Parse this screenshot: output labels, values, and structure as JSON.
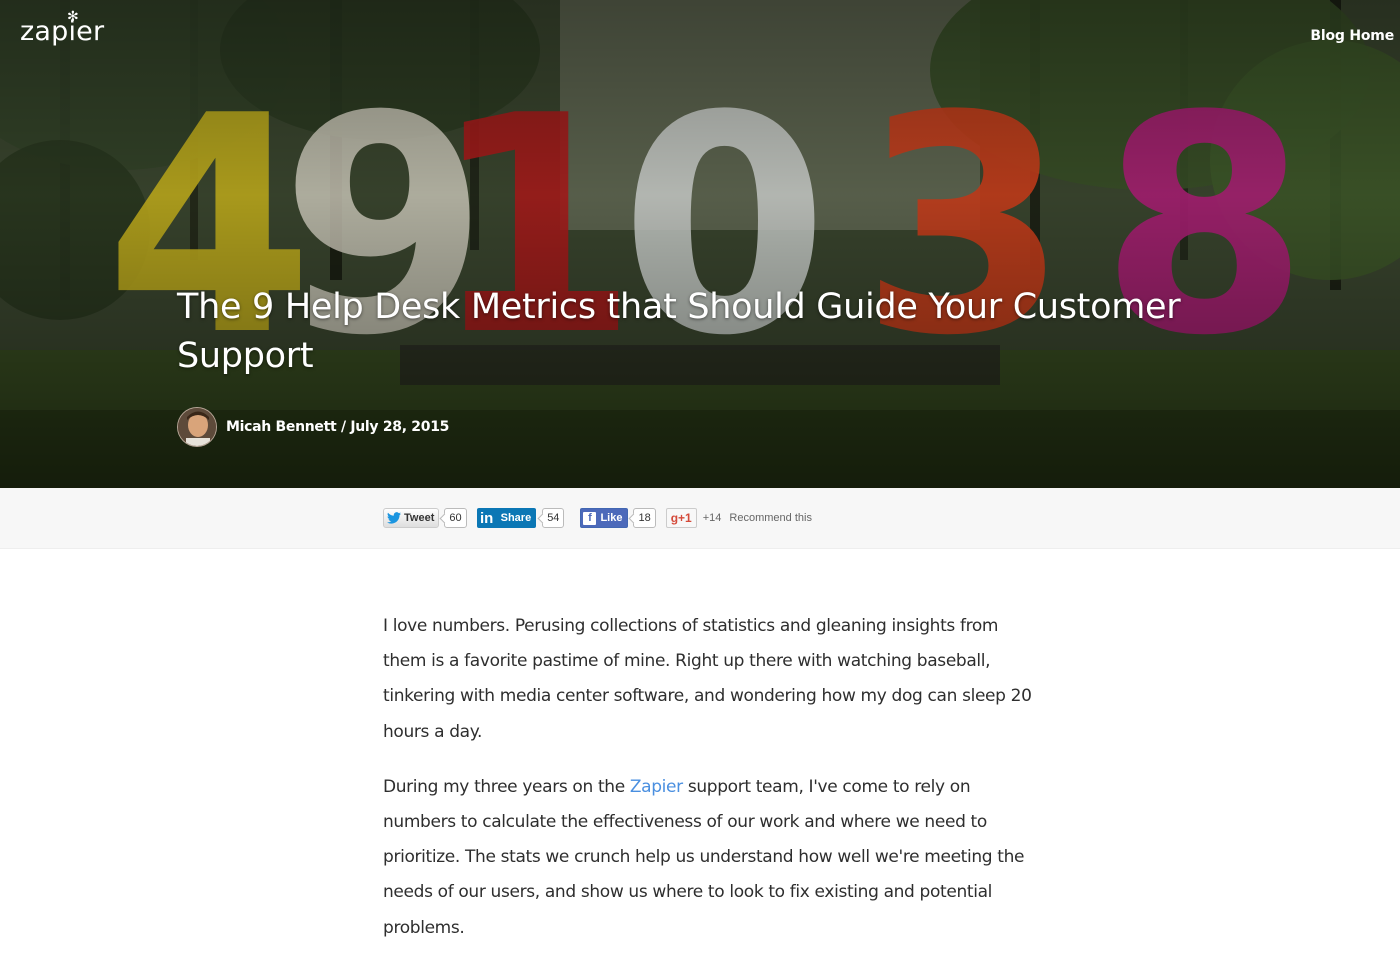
{
  "header": {
    "logo_text": "zapier",
    "blog_home_label": "Blog Home"
  },
  "article": {
    "title": "The 9 Help Desk Metrics that Should Guide Your Customer Support",
    "byline": "Micah Bennett / July 28, 2015"
  },
  "share": {
    "tweet_label": "Tweet",
    "tweet_count": "60",
    "linkedin_label": "Share",
    "linkedin_count": "54",
    "facebook_label": "Like",
    "facebook_count": "18",
    "gplus_label": "+1",
    "gplus_count": "+14",
    "recommend_text": "Recommend this"
  },
  "body": {
    "p1": "I love numbers. Perusing collections of statistics and gleaning insights from them is a favorite pastime of mine. Right up there with watching baseball, tinkering with media center software, and wondering how my dog can sleep 20 hours a day.",
    "p2_before": "During my three years on the ",
    "p2_link": "Zapier",
    "p2_after": " support team, I've come to rely on numbers to calculate the effectiveness of our work and where we need to prioritize. The stats we crunch help us understand how well we're meeting the needs of our users, and show us where to look to fix existing and potential problems."
  },
  "colors": {
    "link": "#4a8fe0",
    "linkedin": "#0b77b5",
    "facebook": "#4c69ba",
    "gplus": "#d44a3a"
  }
}
